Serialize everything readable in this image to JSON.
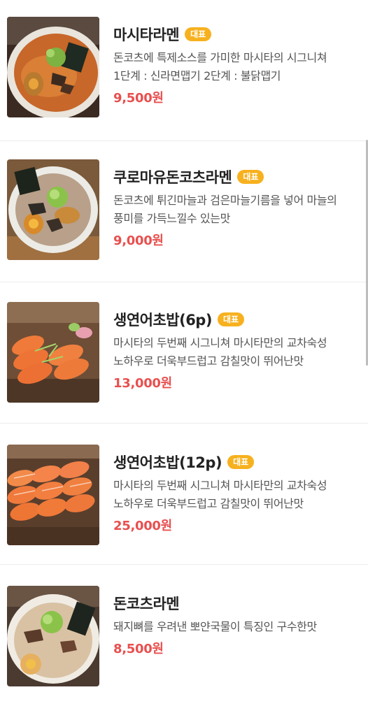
{
  "menu": {
    "items": [
      {
        "name": "마시타라멘",
        "badge": "대표",
        "description": "돈코츠에 특제소스를 가미한 마시타의 시그니쳐 1단계 : 신라면맵기 2단계 : 불닭맵기",
        "price": "9,500원",
        "image": "spicy-ramen-photo"
      },
      {
        "name": "쿠로마유돈코츠라멘",
        "badge": "대표",
        "description": "돈코츠에 튀긴마늘과 검은마늘기름을 넣어 마늘의 풍미를 가득느낄수 있는맛",
        "price": "9,000원",
        "image": "black-garlic-ramen-photo"
      },
      {
        "name": "생연어초밥(6p)",
        "badge": "대표",
        "description": "마시타의 두번째 시그니쳐 마시타만의 교차숙성 노하우로 더욱부드럽고 감칠맛이 뛰어난맛",
        "price": "13,000원",
        "image": "salmon-sushi-6p-photo"
      },
      {
        "name": "생연어초밥(12p)",
        "badge": "대표",
        "description": "마시타의 두번째 시그니쳐 마시타만의 교차숙성 노하우로 더욱부드럽고 감칠맛이 뛰어난맛",
        "price": "25,000원",
        "image": "salmon-sushi-12p-photo"
      },
      {
        "name": "돈코츠라멘",
        "badge": "",
        "description": "돼지뼈를 우려낸 뽀얀국물이 특징인 구수한맛",
        "price": "8,500원",
        "image": "tonkotsu-ramen-photo"
      }
    ]
  },
  "colors": {
    "badge": "#f7b11f",
    "price": "#e8504f",
    "name": "#222222",
    "description": "#555555"
  }
}
